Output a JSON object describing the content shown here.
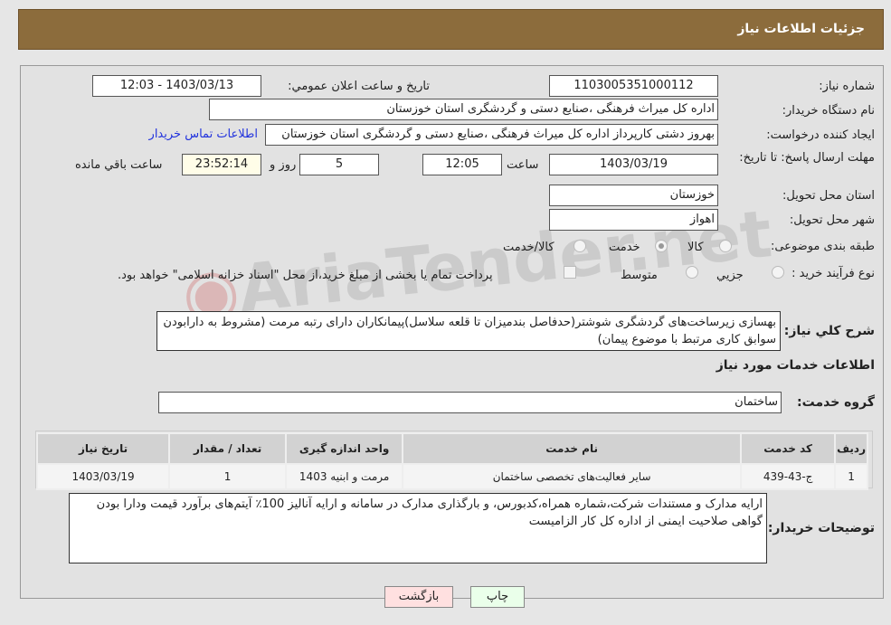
{
  "header": {
    "title": "جزئیات اطلاعات نیاز"
  },
  "form": {
    "need_number_label": "شماره نیاز:",
    "need_number": "1103005351000112",
    "announce_label": "تاریخ و ساعت اعلان عمومي:",
    "announce_value": "1403/03/13 - 12:03",
    "buyer_label": "نام دستگاه خريدار:",
    "buyer_value": "اداره کل میراث فرهنگی ،صنایع دستی و گردشگری استان خوزستان",
    "creator_label": "ايجاد کننده درخواست:",
    "creator_value": "بهروز دشتی کارپرداز اداره کل میراث فرهنگی ،صنایع دستی و گردشگری استان خوزستان",
    "contact_link": "اطلاعات تماس خريدار",
    "deadline_label": "مهلت ارسال پاسخ: تا تاريخ:",
    "deadline_date": "1403/03/19",
    "time_label": "ساعت",
    "deadline_time": "12:05",
    "days_value": "5",
    "days_label": "روز و",
    "remaining_value": "23:52:14",
    "remaining_label": "ساعت باقي مانده",
    "province_label": "استان محل تحويل:",
    "province_value": "خوزستان",
    "city_label": "شهر محل تحويل:",
    "city_value": "اهواز",
    "category_label": "طبقه بندی موضوعی:",
    "category_options": [
      "کالا",
      "خدمت",
      "کالا/خدمت"
    ],
    "category_selected": "خدمت",
    "process_label": "نوع فرآيند خريد :",
    "process_options": [
      "جزيي",
      "متوسط"
    ],
    "payment_note": "پرداخت تمام يا بخشی از مبلغ خريد،از محل \"اسناد خزانه اسلامی\" خواهد بود.",
    "summary_label": "شرح کلي نياز:",
    "summary_value": "بهسازی زیرساخت‌های گردشگری شوشتر(حدفاصل بندمیزان تا قلعه سلاسل)پیمانکاران دارای رتبه مرمت (مشروط به دارابودن سوابق کاری مرتبط با موضوع پیمان)",
    "services_title": "اطلاعات خدمات مورد نياز",
    "group_label": "گروه خدمت:",
    "group_value": "ساختمان"
  },
  "table": {
    "headers": [
      "رديف",
      "کد خدمت",
      "نام خدمت",
      "واحد اندازه گيری",
      "تعداد / مقدار",
      "تاريخ نياز"
    ],
    "rows": [
      [
        "1",
        "ج-43-439",
        "سایر فعالیت‌های تخصصی ساختمان",
        "مرمت و ابنیه 1403",
        "1",
        "1403/03/19"
      ]
    ]
  },
  "notes": {
    "label": "توضيحات خريدار:",
    "value": "ارایه مدارک و مستندات شرکت،شماره همراه،کدبورس، و بارگذاری مدارک در سامانه و ارایه آنالیز 100٪ آیتم‌های برآورد قیمت ودارا بودن گواهی صلاحیت ایمنی از اداره کل کار الزامیست"
  },
  "buttons": {
    "print": "چاپ",
    "back": "بازگشت"
  },
  "watermark": "AriaTender.net"
}
